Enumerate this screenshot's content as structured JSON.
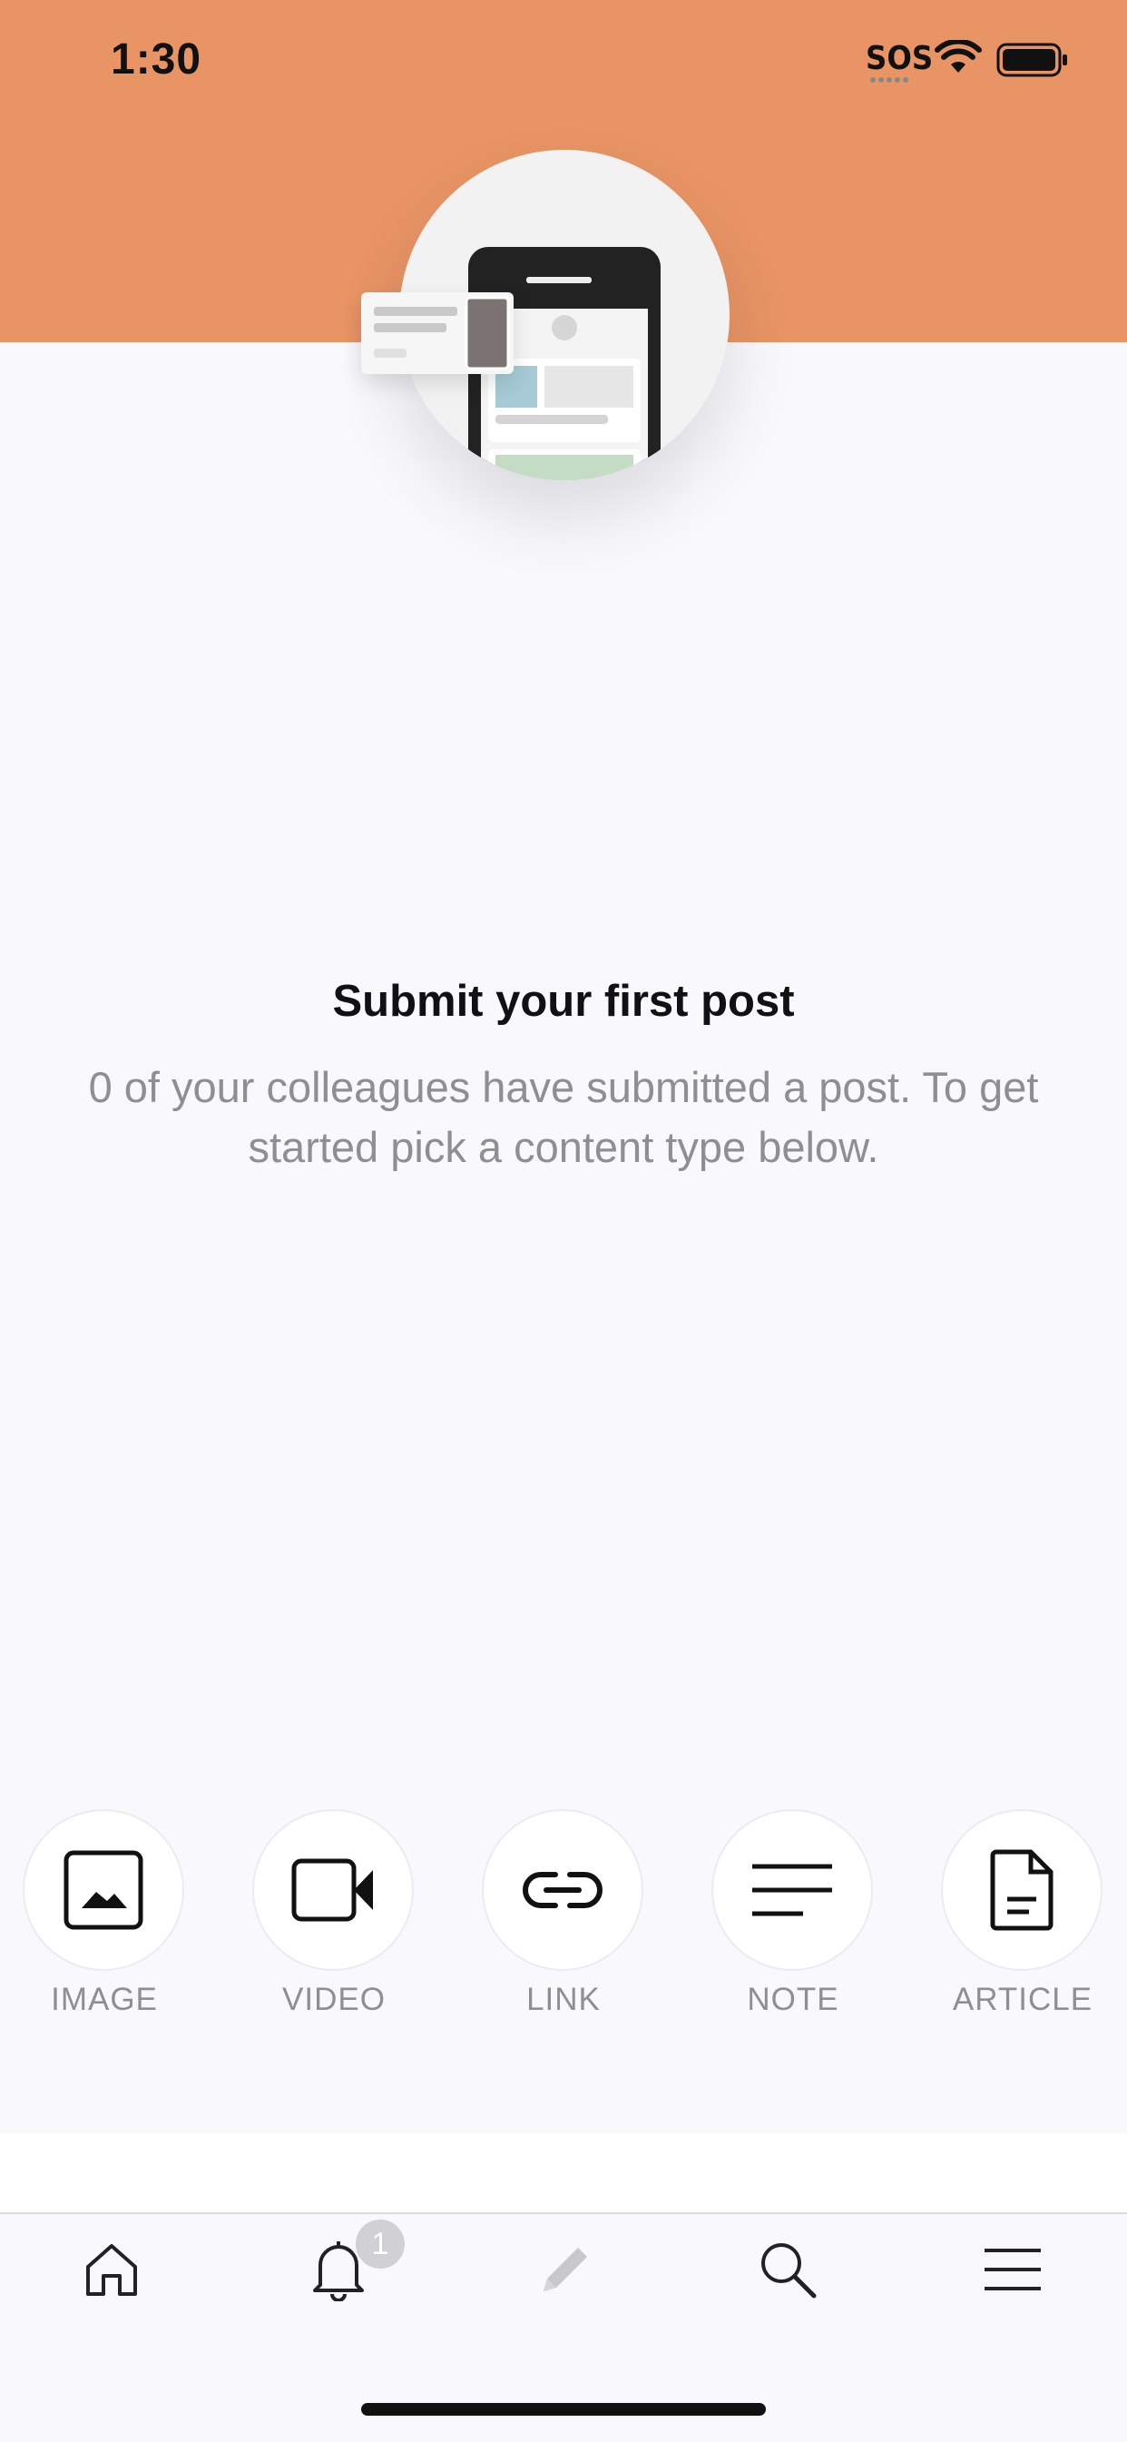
{
  "status_bar": {
    "time": "1:30",
    "sos": "SOS"
  },
  "hero": {
    "illustration": "phone-feed-illustration"
  },
  "empty_state": {
    "title": "Submit your first post",
    "description": "0 of your colleagues have submitted a post. To get started pick a content type below."
  },
  "content_types": [
    {
      "label": "IMAGE",
      "icon": "image-icon"
    },
    {
      "label": "VIDEO",
      "icon": "video-camera-icon"
    },
    {
      "label": "LINK",
      "icon": "link-icon"
    },
    {
      "label": "NOTE",
      "icon": "note-lines-icon"
    },
    {
      "label": "ARTICLE",
      "icon": "document-icon"
    }
  ],
  "tab_bar": {
    "items": [
      {
        "name": "home",
        "icon": "home-icon"
      },
      {
        "name": "notifications",
        "icon": "bell-icon",
        "badge": "1"
      },
      {
        "name": "compose",
        "icon": "pencil-icon"
      },
      {
        "name": "search",
        "icon": "search-icon"
      },
      {
        "name": "menu",
        "icon": "menu-icon"
      }
    ]
  },
  "colors": {
    "header": "#e89465",
    "background": "#f8f8fd",
    "muted_text": "#8e8e93"
  }
}
